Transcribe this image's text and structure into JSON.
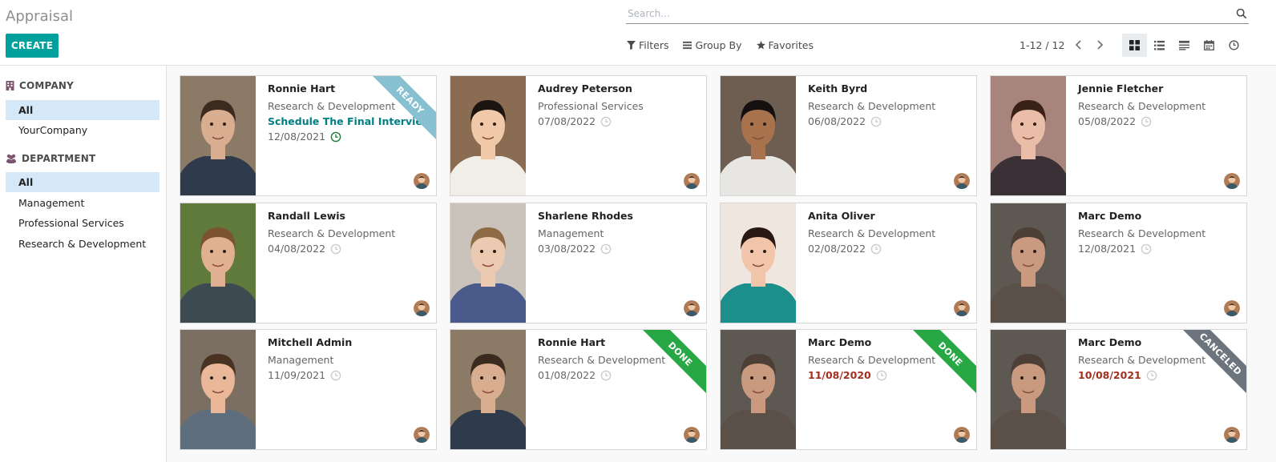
{
  "header": {
    "breadcrumb": "Appraisal",
    "create_label": "CREATE",
    "search_placeholder": "Search...",
    "filters_label": "Filters",
    "groupby_label": "Group By",
    "favorites_label": "Favorites",
    "pager": "1-12 / 12"
  },
  "sidebar": {
    "company_title": "COMPANY",
    "company_items": [
      "All",
      "YourCompany"
    ],
    "department_title": "DEPARTMENT",
    "department_items": [
      "All",
      "Management",
      "Professional Services",
      "Research & Development"
    ]
  },
  "cards": [
    {
      "name": "Ronnie Hart",
      "dept": "Research & Development",
      "activity": "Schedule The Final Interview",
      "date": "12/08/2021",
      "ribbon": "READY",
      "ribbon_color": "#87c0d1",
      "photo": "ronnie"
    },
    {
      "name": "Audrey Peterson",
      "dept": "Professional Services",
      "activity": "",
      "date": "07/08/2022",
      "ribbon": "",
      "photo": "audrey"
    },
    {
      "name": "Keith Byrd",
      "dept": "Research & Development",
      "activity": "",
      "date": "06/08/2022",
      "ribbon": "",
      "photo": "keith"
    },
    {
      "name": "Jennie Fletcher",
      "dept": "Research & Development",
      "activity": "",
      "date": "05/08/2022",
      "ribbon": "",
      "photo": "jennie"
    },
    {
      "name": "Randall Lewis",
      "dept": "Research & Development",
      "activity": "",
      "date": "04/08/2022",
      "ribbon": "",
      "photo": "randall"
    },
    {
      "name": "Sharlene Rhodes",
      "dept": "Management",
      "activity": "",
      "date": "03/08/2022",
      "ribbon": "",
      "photo": "sharlene"
    },
    {
      "name": "Anita Oliver",
      "dept": "Research & Development",
      "activity": "",
      "date": "02/08/2022",
      "ribbon": "",
      "photo": "anita"
    },
    {
      "name": "Marc Demo",
      "dept": "Research & Development",
      "activity": "",
      "date": "12/08/2021",
      "ribbon": "",
      "photo": "marc"
    },
    {
      "name": "Mitchell Admin",
      "dept": "Management",
      "activity": "",
      "date": "11/09/2021",
      "ribbon": "",
      "photo": "mitchell"
    },
    {
      "name": "Ronnie Hart",
      "dept": "Research & Development",
      "activity": "",
      "date": "01/08/2022",
      "ribbon": "DONE",
      "ribbon_color": "#28a745",
      "photo": "ronnie"
    },
    {
      "name": "Marc Demo",
      "dept": "Research & Development",
      "activity": "",
      "date": "11/08/2020",
      "overdue": true,
      "ribbon": "DONE",
      "ribbon_color": "#28a745",
      "photo": "marc"
    },
    {
      "name": "Marc Demo",
      "dept": "Research & Development",
      "activity": "",
      "date": "10/08/2021",
      "overdue": true,
      "ribbon": "CANCELED",
      "ribbon_color": "#6c757d",
      "photo": "marc"
    }
  ],
  "colors": {
    "accent": "#00a09d",
    "overdue": "#a42e1f",
    "activity": "#017e84"
  }
}
